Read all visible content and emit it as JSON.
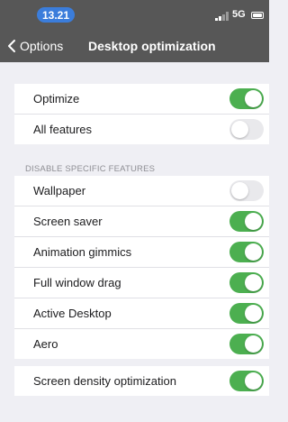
{
  "status_bar": {
    "time": "13.21",
    "network": "5G",
    "icons": [
      "signal-icon",
      "battery-icon"
    ]
  },
  "nav": {
    "back_label": "Options",
    "title": "Desktop optimization",
    "back_icon": "chevron-left-icon"
  },
  "group1": {
    "items": [
      {
        "label": "Optimize",
        "on": true
      },
      {
        "label": "All features",
        "on": false
      }
    ]
  },
  "section_header": "DISABLE SPECIFIC FEATURES",
  "group2": {
    "items": [
      {
        "label": "Wallpaper",
        "on": false
      },
      {
        "label": "Screen saver",
        "on": true
      },
      {
        "label": "Animation gimmics",
        "on": true
      },
      {
        "label": "Full window drag",
        "on": true
      },
      {
        "label": "Active Desktop",
        "on": true
      },
      {
        "label": "Aero",
        "on": true
      }
    ]
  },
  "group3": {
    "items": [
      {
        "label": "Screen density optimization",
        "on": true
      }
    ]
  },
  "colors": {
    "toggle_on": "#4caf50",
    "toggle_off": "#e9e9ec",
    "nav_background": "#575757",
    "time_pill": "#3b7ddb"
  }
}
